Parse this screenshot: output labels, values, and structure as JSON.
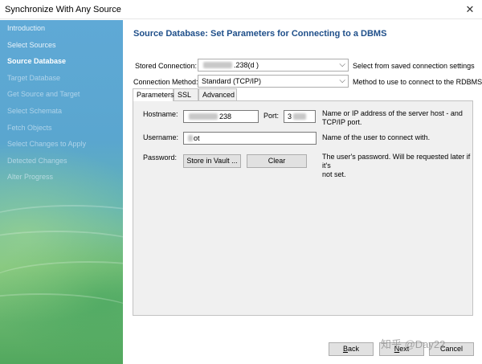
{
  "window": {
    "title": "Synchronize With Any Source"
  },
  "sidebar": {
    "items": [
      {
        "label": "Introduction",
        "state": "done"
      },
      {
        "label": "Select Sources",
        "state": "done"
      },
      {
        "label": "Source Database",
        "state": "current"
      },
      {
        "label": "Target Database",
        "state": "disabled"
      },
      {
        "label": "Get Source and Target",
        "state": "disabled"
      },
      {
        "label": "Select Schemata",
        "state": "disabled"
      },
      {
        "label": "Fetch Objects",
        "state": "disabled"
      },
      {
        "label": "Select Changes to Apply",
        "state": "disabled"
      },
      {
        "label": "Detected Changes",
        "state": "disabled"
      },
      {
        "label": "Alter Progress",
        "state": "disabled"
      }
    ]
  },
  "page": {
    "heading": "Source Database: Set Parameters for Connecting to a DBMS",
    "stored_connection": {
      "label": "Stored Connection:",
      "value": ".238(d )",
      "help": "Select from saved connection settings"
    },
    "connection_method": {
      "label": "Connection Method:",
      "value": "Standard (TCP/IP)",
      "help": "Method to use to connect to the RDBMS"
    },
    "tabs": [
      {
        "label": "Parameters",
        "active": true
      },
      {
        "label": "SSL",
        "active": false
      },
      {
        "label": "Advanced",
        "active": false
      }
    ],
    "parameters": {
      "hostname": {
        "label": "Hostname:",
        "value": "238"
      },
      "port": {
        "label": "Port:",
        "value": "3"
      },
      "hostname_help_1": "Name or IP address of the server host - and",
      "hostname_help_2": "TCP/IP port.",
      "username": {
        "label": "Username:",
        "value": "ot",
        "help": "Name of the user to connect with."
      },
      "password": {
        "label": "Password:",
        "store_label": "Store in Vault ...",
        "clear_label": "Clear",
        "help_1": "The user's password. Will be requested later if it's",
        "help_2": "not set."
      }
    }
  },
  "footer": {
    "back_label": "ack",
    "back_mnemonic": "B",
    "next_label": "ext",
    "next_mnemonic": "N",
    "cancel_label": "Cancel"
  },
  "watermark": "知乎 @Day22",
  "colors": {
    "heading": "#1f4f8a",
    "sidebar_top": "#5fa9d6",
    "sidebar_bottom": "#52a85e"
  }
}
